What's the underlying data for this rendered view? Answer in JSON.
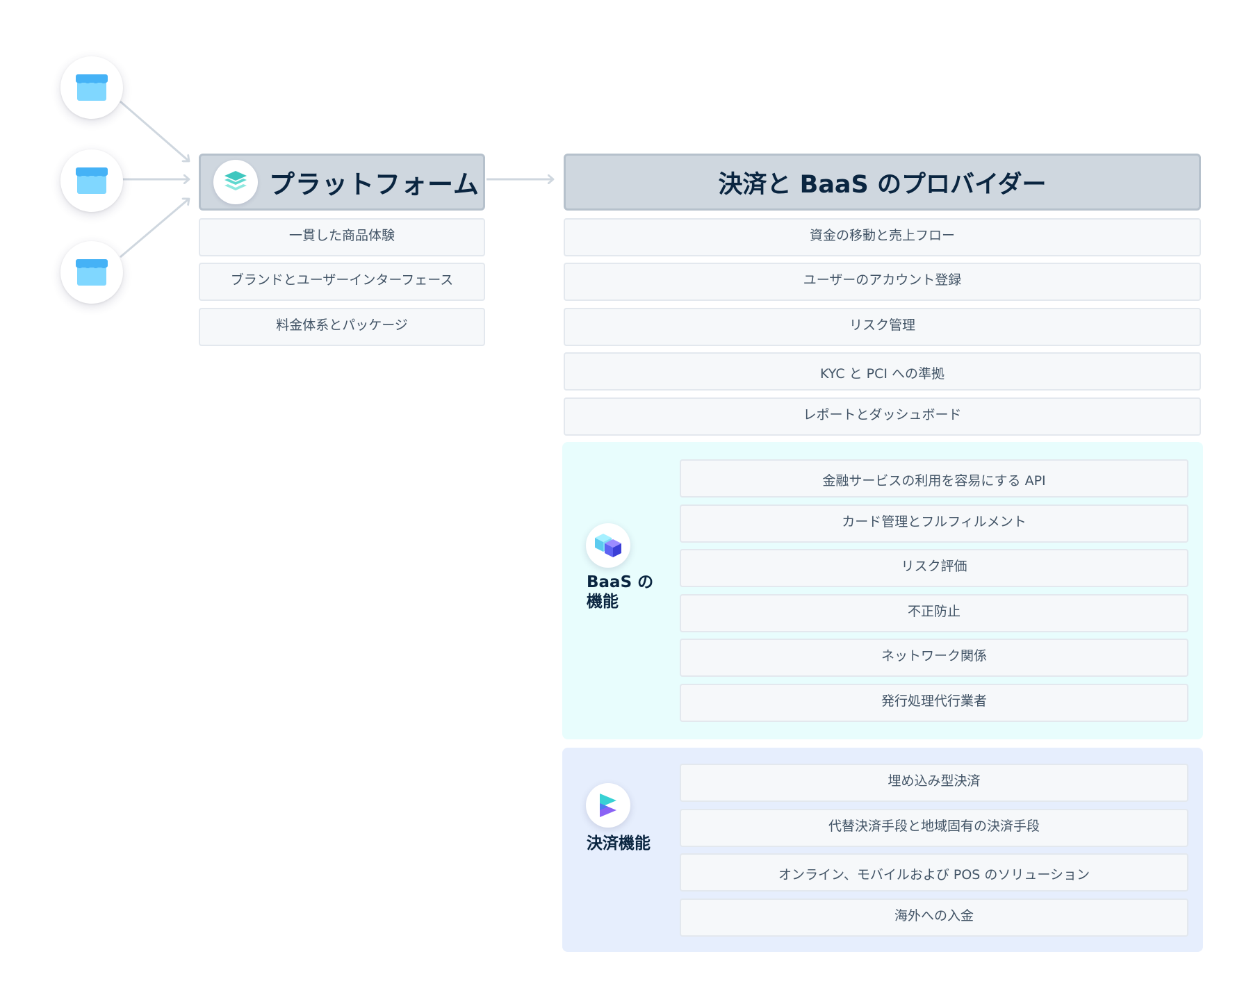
{
  "platform": {
    "title": "プラットフォーム",
    "icon": "layers-icon",
    "items": [
      "一貫した商品体験",
      "ブランドとユーザーインターフェース",
      "料金体系とパッケージ"
    ]
  },
  "provider": {
    "title": "決済と BaaS のプロバイダー",
    "items": [
      "資金の移動と売上フロー",
      "ユーザーのアカウント登録",
      "リスク管理",
      "KYC と PCI への準拠",
      "レポートとダッシュボード"
    ]
  },
  "baas": {
    "title": "BaaS の機能",
    "icon": "cube-icon",
    "items": [
      "金融サービスの利用を容易にする API",
      "カード管理とフルフィルメント",
      "リスク評価",
      "不正防止",
      "ネットワーク関係",
      "発行処理代行業者"
    ]
  },
  "payments": {
    "title": "決済機能",
    "icon": "play-icon",
    "items": [
      "埋め込み型決済",
      "代替決済手段と地域固有の決済手段",
      "オンライン、モバイルおよび POS のソリューション",
      "海外への入金"
    ]
  },
  "stores": [
    "store-icon",
    "store-icon",
    "store-icon"
  ],
  "colors": {
    "header_bg": "#cfd7df",
    "item_bg": "#f6f8fa",
    "baas_bg": "#e8fdfd",
    "payments_bg": "#e6eefd",
    "title_text": "#0a2540",
    "arrow": "#cfd7df"
  }
}
